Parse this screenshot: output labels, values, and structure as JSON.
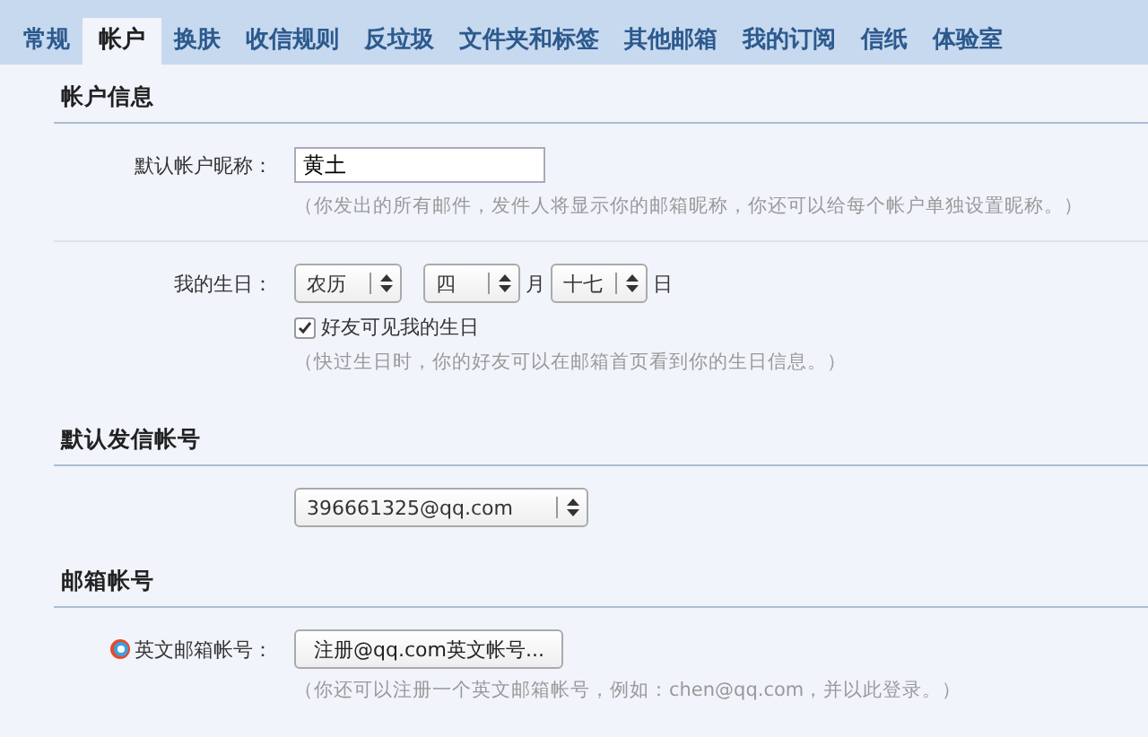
{
  "tabs": [
    {
      "label": "常规",
      "selected": false
    },
    {
      "label": "帐户",
      "selected": true
    },
    {
      "label": "换肤",
      "selected": false
    },
    {
      "label": "收信规则",
      "selected": false
    },
    {
      "label": "反垃圾",
      "selected": false
    },
    {
      "label": "文件夹和标签",
      "selected": false
    },
    {
      "label": "其他邮箱",
      "selected": false
    },
    {
      "label": "我的订阅",
      "selected": false
    },
    {
      "label": "信纸",
      "selected": false
    },
    {
      "label": "体验室",
      "selected": false
    }
  ],
  "account_info": {
    "title": "帐户信息",
    "nickname": {
      "label": "默认帐户昵称：",
      "value": "黄土",
      "hint": "（你发出的所有邮件，发件人将显示你的邮箱昵称，你还可以给每个帐户单独设置昵称。）"
    },
    "birthday": {
      "label": "我的生日：",
      "calendar": "农历",
      "month": "四",
      "month_unit": "月",
      "day": "十七",
      "day_unit": "日",
      "visible_to_friends": {
        "label": "好友可见我的生日",
        "checked": true
      },
      "hint": "（快过生日时，你的好友可以在邮箱首页看到你的生日信息。）"
    }
  },
  "default_sender": {
    "title": "默认发信帐号",
    "account": "396661325@qq.com"
  },
  "mailbox_account": {
    "title": "邮箱帐号",
    "english": {
      "label": "英文邮箱帐号：",
      "button": "注册@qq.com英文帐号...",
      "hint": "（你还可以注册一个英文邮箱帐号，例如：chen@qq.com，并以此登录。）"
    }
  }
}
